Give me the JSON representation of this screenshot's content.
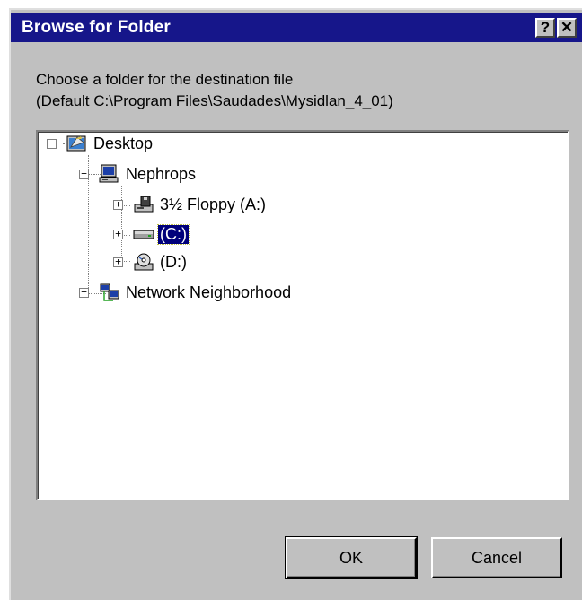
{
  "window": {
    "title": "Browse for Folder",
    "help_glyph": "?",
    "close_glyph": "✕"
  },
  "prompt": {
    "line1": "Choose a folder for the destination file",
    "line2": "(Default C:\\Program Files\\Saudades\\Mysidlan_4_01)"
  },
  "tree": {
    "desktop": "Desktop",
    "computer": "Nephrops",
    "floppy": "3½ Floppy (A:)",
    "drive_c": "(C:)",
    "drive_d": "(D:)",
    "network": "Network Neighborhood",
    "selected": "drive_c"
  },
  "buttons": {
    "ok": "OK",
    "cancel": "Cancel"
  },
  "colors": {
    "titlebar": "#16168a",
    "face": "#c0c0c0",
    "selection": "#00007b"
  }
}
